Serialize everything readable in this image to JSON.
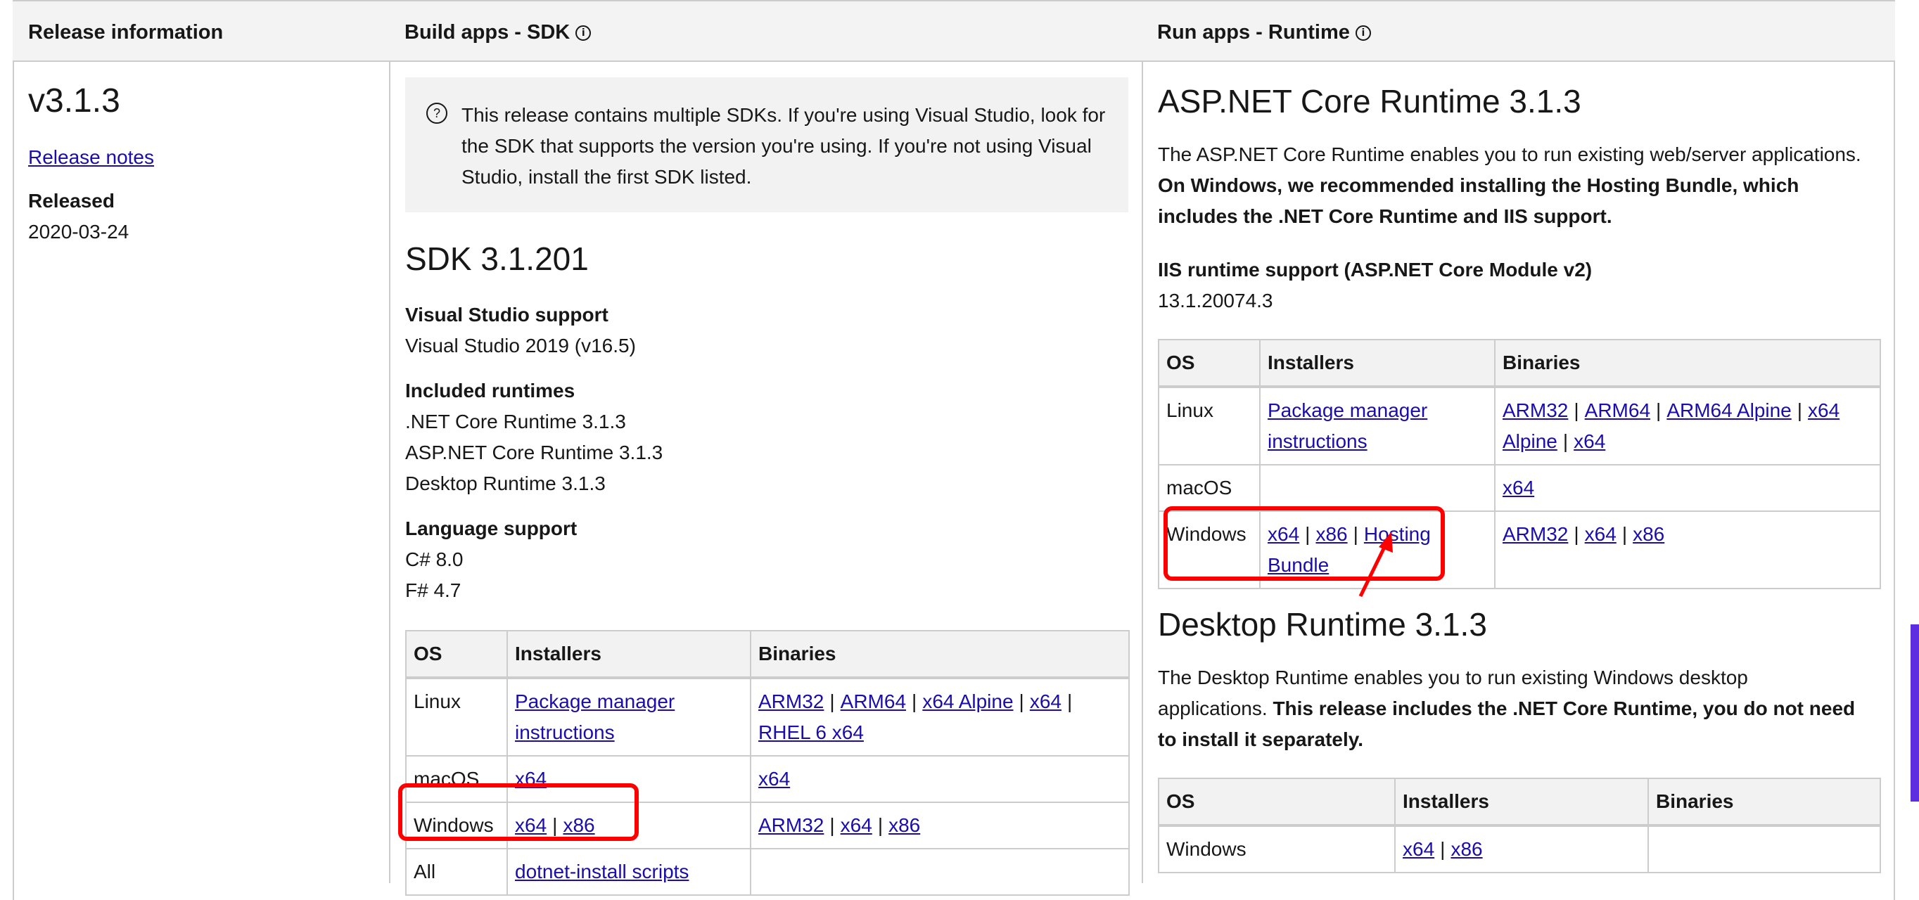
{
  "header": {
    "col1": "Release information",
    "col2": "Build apps - SDK",
    "col3": "Run apps - Runtime",
    "info_icon": "ⓘ"
  },
  "release": {
    "version": "v3.1.3",
    "notes_link": "Release notes",
    "released_label": "Released",
    "released_date": "2020-03-24"
  },
  "sdk": {
    "notice": "This release contains multiple SDKs. If you're using Visual Studio, look for the SDK that supports the version you're using. If you're not using Visual Studio, install the first SDK listed.",
    "notice_icon": "question-circle-icon",
    "title": "SDK 3.1.201",
    "vs_support_label": "Visual Studio support",
    "vs_support_value": "Visual Studio 2019 (v16.5)",
    "runtimes_label": "Included runtimes",
    "runtimes": [
      ".NET Core Runtime 3.1.3",
      "ASP.NET Core Runtime 3.1.3",
      "Desktop Runtime 3.1.3"
    ],
    "lang_label": "Language support",
    "languages": [
      "C# 8.0",
      "F# 4.7"
    ],
    "table": {
      "headers": [
        "OS",
        "Installers",
        "Binaries"
      ],
      "rows": [
        {
          "os": "Linux",
          "installers": [
            "Package manager instructions"
          ],
          "binaries": [
            "ARM32",
            "ARM64",
            "x64 Alpine",
            "x64",
            "RHEL 6 x64"
          ]
        },
        {
          "os": "macOS",
          "installers": [
            "x64"
          ],
          "binaries": [
            "x64"
          ]
        },
        {
          "os": "Windows",
          "installers": [
            "x64",
            "x86"
          ],
          "binaries": [
            "ARM32",
            "x64",
            "x86"
          ]
        },
        {
          "os": "All",
          "installers": [
            "dotnet-install scripts"
          ],
          "binaries": []
        }
      ]
    }
  },
  "aspnet": {
    "title": "ASP.NET Core Runtime 3.1.3",
    "desc_plain": "The ASP.NET Core Runtime enables you to run existing web/server applications. ",
    "desc_bold": "On Windows, we recommended installing the Hosting Bundle, which includes the .NET Core Runtime and IIS support.",
    "iis_label": "IIS runtime support (ASP.NET Core Module v2)",
    "iis_value": "13.1.20074.3",
    "table": {
      "headers": [
        "OS",
        "Installers",
        "Binaries"
      ],
      "rows": [
        {
          "os": "Linux",
          "installers": [
            "Package manager instructions"
          ],
          "binaries": [
            "ARM32",
            "ARM64",
            "ARM64 Alpine",
            "x64 Alpine",
            "x64"
          ]
        },
        {
          "os": "macOS",
          "installers": [],
          "binaries": [
            "x64"
          ]
        },
        {
          "os": "Windows",
          "installers": [
            "x64",
            "x86",
            "Hosting Bundle"
          ],
          "binaries": [
            "ARM32",
            "x64",
            "x86"
          ]
        }
      ]
    }
  },
  "desktop": {
    "title": "Desktop Runtime 3.1.3",
    "desc_plain": "The Desktop Runtime enables you to run existing Windows desktop applications. ",
    "desc_bold": "This release includes the .NET Core Runtime, you do not need to install it separately.",
    "table": {
      "headers": [
        "OS",
        "Installers",
        "Binaries"
      ],
      "rows": [
        {
          "os": "Windows",
          "installers": [
            "x64",
            "x86"
          ],
          "binaries": []
        }
      ]
    }
  },
  "annotations": {
    "highlight_color": "#ff0000",
    "link_color": "#1a0dab"
  }
}
